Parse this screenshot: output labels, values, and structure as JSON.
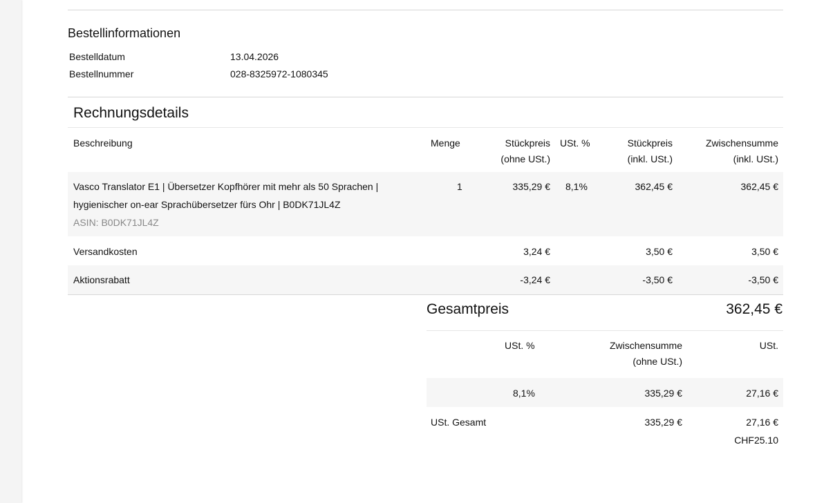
{
  "order_info": {
    "title": "Bestellinformationen",
    "rows": [
      {
        "label": "Bestelldatum",
        "value": "13.04.2026"
      },
      {
        "label": "Bestellnummer",
        "value": "028-8325972-1080345"
      }
    ]
  },
  "invoice": {
    "title": "Rechnungsdetails",
    "headers": {
      "description": "Beschreibung",
      "quantity": "Menge",
      "unit_net_1": "Stückpreis",
      "unit_net_2": "(ohne USt.)",
      "vat_pct": "USt. %",
      "unit_gross_1": "Stückpreis",
      "unit_gross_2": "(inkl. USt.)",
      "subtotal_1": "Zwischensumme",
      "subtotal_2": "(inkl. USt.)"
    },
    "item": {
      "description_line1": "Vasco Translator E1 | Übersetzer Kopfhörer mit mehr als 50 Sprachen |",
      "description_line2": "hygienischer on-ear Sprachübersetzer fürs Ohr | B0DK71JL4Z",
      "asin": "ASIN: B0DK71JL4Z",
      "quantity": "1",
      "unit_net": "335,29 €",
      "vat_pct": "8,1%",
      "unit_gross": "362,45 €",
      "subtotal": "362,45 €"
    },
    "shipping": {
      "label": "Versandkosten",
      "unit_net": "3,24 €",
      "unit_gross": "3,50 €",
      "subtotal": "3,50 €"
    },
    "discount": {
      "label": "Aktionsrabatt",
      "unit_net": "-3,24 €",
      "unit_gross": "-3,50 €",
      "subtotal": "-3,50 €"
    }
  },
  "total": {
    "label": "Gesamtpreis",
    "value": "362,45 €"
  },
  "vat_table": {
    "headers": {
      "vat_pct": "USt. %",
      "net_subtotal_1": "Zwischensumme",
      "net_subtotal_2": "(ohne USt.)",
      "vat": "USt."
    },
    "row": {
      "vat_pct": "8,1%",
      "net_subtotal": "335,29 €",
      "vat": "27,16 €"
    },
    "sum": {
      "label": "USt. Gesamt",
      "net_subtotal": "335,29 €",
      "vat": "27,16 €",
      "vat_chf": "CHF25.10"
    }
  }
}
